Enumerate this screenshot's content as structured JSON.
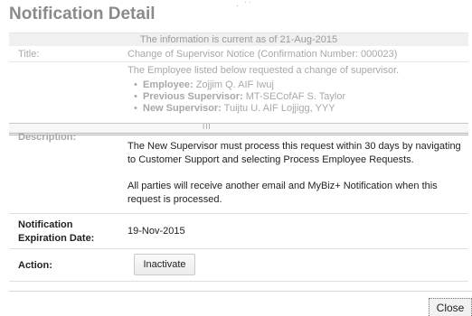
{
  "dialog": {
    "title": "Notification Detail",
    "title_mark": "· ˙˙"
  },
  "info_line": "The information is current as of 21-Aug-2015",
  "title_row": {
    "label": "Title:",
    "value": "Change of Supervisor Notice (Confirmation Number: 000023)"
  },
  "description": {
    "label": "Description:",
    "intro": "The Employee listed below requested a change of supervisor.",
    "bullets": [
      {
        "label": "Employee:",
        "value": "Zojjim Q. AIF Iwuj"
      },
      {
        "label": "Previous Supervisor:",
        "value": "MT-SECofAF S. Taylor"
      },
      {
        "label": "New Supervisor:",
        "value": "Tuijtu U. AIF Lojjigg, YYY"
      }
    ],
    "grip": "III",
    "paragraph_1": "The New Supervisor must process this request within 30 days by navigating to Customer Support and selecting Process Employee Requests.",
    "paragraph_2": "All parties will receive another email and MyBiz+ Notification when this request is processed."
  },
  "expiration": {
    "label": "Notification Expiration Date:",
    "value": "19-Nov-2015"
  },
  "action": {
    "label": "Action:",
    "button": "Inactivate"
  },
  "footer": {
    "close": "Close"
  },
  "bullet_glyph": "•"
}
